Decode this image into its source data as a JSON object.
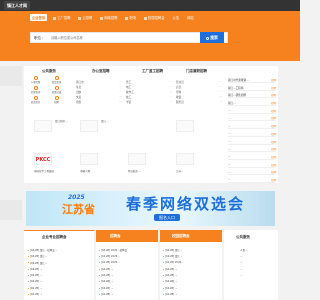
{
  "header": {
    "logo": "镇江人才网"
  },
  "nav": {
    "items": [
      {
        "label": "企业登录",
        "active": true
      },
      {
        "label": "工厂招聘"
      },
      {
        "label": "云招聘"
      },
      {
        "label": "网络招聘"
      },
      {
        "label": "职场"
      },
      {
        "label": "校园招聘会"
      },
      {
        "label": "公告"
      },
      {
        "label": "网站"
      }
    ]
  },
  "search": {
    "type_label": "职位",
    "caret": "▾",
    "placeholder": "请输入职位或公司名称",
    "button_label": "搜索"
  },
  "sections": {
    "public_service": "公共服务",
    "office": "办公室招聘",
    "factory": "工厂蓝工招聘",
    "store": "门店兼职招聘",
    "job_fair": "企业专业招聘会",
    "campus_fair": "招聘会",
    "school_fair": "校园招聘会",
    "public_service2": "公共服务"
  },
  "service_icons": [
    {
      "label": "人事代理"
    },
    {
      "label": "档案查询"
    },
    {
      "label": "社保查询"
    },
    {
      "label": "政策法规"
    },
    {
      "label": "就业指导"
    },
    {
      "label": "招聘"
    }
  ],
  "office_list": [
    {
      "name": "镇江市",
      "tag": "..."
    },
    {
      "name": "专员",
      "tag": "..."
    },
    {
      "name": "出纳",
      "tag": "..."
    },
    {
      "name": "文员",
      "tag": "..."
    },
    {
      "name": "销售",
      "tag": "..."
    }
  ],
  "factory_list": [
    {
      "name": "普工",
      "tag": "..."
    },
    {
      "name": "电工",
      "tag": "..."
    },
    {
      "name": "操作工",
      "tag": "..."
    },
    {
      "name": "技工",
      "tag": "..."
    },
    {
      "name": "学徒",
      "tag": "..."
    }
  ],
  "store_list": [
    {
      "name": "营业员",
      "tag": "..."
    },
    {
      "name": "店长",
      "tag": "..."
    },
    {
      "name": "导购",
      "tag": "..."
    },
    {
      "name": "收银",
      "tag": "..."
    },
    {
      "name": "服务员",
      "tag": "..."
    }
  ],
  "companies": [
    {
      "name": "PKCC",
      "desc": "中国化学工程集团"
    },
    {
      "name": "",
      "desc": "镇江新区..."
    },
    {
      "name": "",
      "desc": "镇江..."
    },
    {
      "name": "",
      "desc": "中國人壽"
    },
    {
      "name": "",
      "desc": "物业服务..."
    },
    {
      "name": "",
      "desc": "江苏..."
    }
  ],
  "right_list": [
    {
      "name": "镇江时代新能源...",
      "tag": "招聘"
    },
    {
      "name": "镇江...工程师",
      "tag": "招聘"
    },
    {
      "name": "镇江...销售招聘",
      "tag": "招聘"
    },
    {
      "name": "镇江...",
      "tag": "招聘"
    },
    {
      "name": "...",
      "tag": "招聘"
    },
    {
      "name": "...",
      "tag": "招聘"
    },
    {
      "name": "...",
      "tag": "招聘"
    },
    {
      "name": "...",
      "tag": "招聘"
    },
    {
      "name": "...",
      "tag": "招聘"
    },
    {
      "name": "...",
      "tag": "招聘"
    },
    {
      "name": "...",
      "tag": "招聘"
    },
    {
      "name": "...",
      "tag": "招聘"
    },
    {
      "name": "...",
      "tag": "招聘"
    },
    {
      "name": "...",
      "tag": "招聘"
    }
  ],
  "banner": {
    "year": "2025",
    "province": "江苏省",
    "main": "春季网络双选会",
    "sub": "报名入口"
  },
  "fair_rows": [
    "[04.28] 镇江...招聘会...",
    "[04.28] 镇江...",
    "[04.28] 镇江...",
    "[04.28] ...",
    "[04.28] ...",
    "[04.28] ...",
    "[04.28] ...",
    "[04.28] ..."
  ],
  "fair_rows2": [
    "[04.28] 2025...招聘会",
    "[04.28] 2025...",
    "[04.28] 2025...",
    "[04.28] ...",
    "[04.28] ...",
    "[04.28] ...",
    "[04.28] ...",
    "[04.28] ..."
  ],
  "fair_rows3": [
    "[04.28] 镇江...",
    "[04.28] 镇江...",
    "[04.28] 2025...",
    "[04.28] ...",
    "[04.28] ...",
    "[04.28] ...",
    "[04.28] ...",
    "[04.28] ..."
  ],
  "right_panel": [
    "人事...",
    "...",
    "...",
    "...",
    "..."
  ]
}
